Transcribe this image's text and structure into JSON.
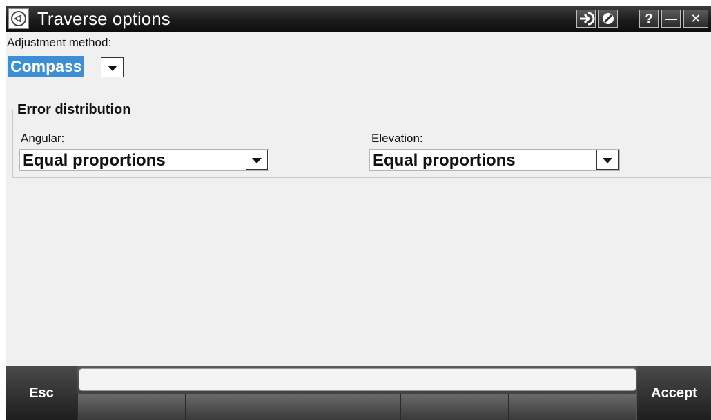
{
  "window": {
    "title": "Traverse options",
    "icons": [
      "app-logo-icon",
      "enter-icon",
      "cancel-icon"
    ],
    "help_label": "?",
    "minimize_label": "—",
    "close_label": "✕"
  },
  "adjustment": {
    "label": "Adjustment method:",
    "value": "Compass"
  },
  "error_distribution": {
    "title": "Error distribution",
    "angular": {
      "label": "Angular:",
      "value": "Equal proportions"
    },
    "elevation": {
      "label": "Elevation:",
      "value": "Equal proportions"
    }
  },
  "softkeys": {
    "esc_label": "Esc",
    "accept_label": "Accept"
  },
  "colors": {
    "selection": "#3c8fd6",
    "titlebar": "#1c1c1c",
    "background": "#f0f0f0"
  }
}
